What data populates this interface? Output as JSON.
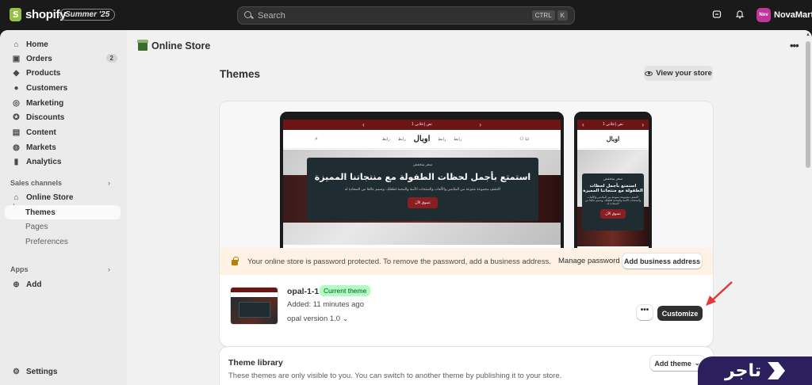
{
  "topbar": {
    "brand": "shopify",
    "edition": "Summer '25",
    "search_placeholder": "Search",
    "kbd_ctrl": "CTRL",
    "kbd_k": "K",
    "avatar_initials": "Nov",
    "store_name": "NovaMart"
  },
  "sidebar": {
    "items": [
      {
        "label": "Home"
      },
      {
        "label": "Orders",
        "badge": "2"
      },
      {
        "label": "Products"
      },
      {
        "label": "Customers"
      },
      {
        "label": "Marketing"
      },
      {
        "label": "Discounts"
      },
      {
        "label": "Content"
      },
      {
        "label": "Markets"
      },
      {
        "label": "Analytics"
      }
    ],
    "sales_channels_label": "Sales channels",
    "online_store": "Online Store",
    "sub_items": [
      {
        "label": "Themes"
      },
      {
        "label": "Pages"
      },
      {
        "label": "Preferences"
      }
    ],
    "apps_label": "Apps",
    "add_label": "Add",
    "settings_label": "Settings"
  },
  "header": {
    "section_title": "Online Store",
    "page_title": "Themes",
    "view_store": "View your store"
  },
  "preview": {
    "announcement": "نص إعلاني 1",
    "logo": "اوبال",
    "nav_link": "رابط",
    "hero_kicker": "سعر منخفض",
    "hero_heading": "استمتع بأجمل لحظات الطفولة مع منتجاتنا المميزة",
    "hero_text": "اكتشف مجموعة متنوعة من الملابس والألعاب والمنتجات الآمنة والمحبة لطفلك، وصمم عالمًا من السعادة له",
    "hero_button": "تسوق الآن",
    "mobile_heading": "استمتع بأجمل لحظات الطفولة مع منتجاتنا المميزة",
    "mobile_text": "اكتشف مجموعة متنوعة من الملابس والألعاب والمنتجات الآمنة والمحبة لطفلك، وصمم عالمًا من السعادة له"
  },
  "warning": {
    "text": "Your online store is password protected. To remove the password, add a business address.",
    "manage_password": "Manage password",
    "add_business_address": "Add business address"
  },
  "current_theme": {
    "name": "opal-1-1",
    "badge": "Current theme",
    "added": "Added: 11 minutes ago",
    "version": "opal version 1.0",
    "more_label": "•••",
    "customize": "Customize"
  },
  "library": {
    "title": "Theme library",
    "description": "These themes are only visible to you. You can switch to another theme by publishing it to your store.",
    "add_theme": "Add theme"
  },
  "watermark": {
    "text": "تاجر"
  },
  "colors": {
    "accent_dark": "#303030",
    "badge_green": "#affebf",
    "warning_bg": "#fff1e3",
    "arrow_red": "#e03a3a"
  }
}
